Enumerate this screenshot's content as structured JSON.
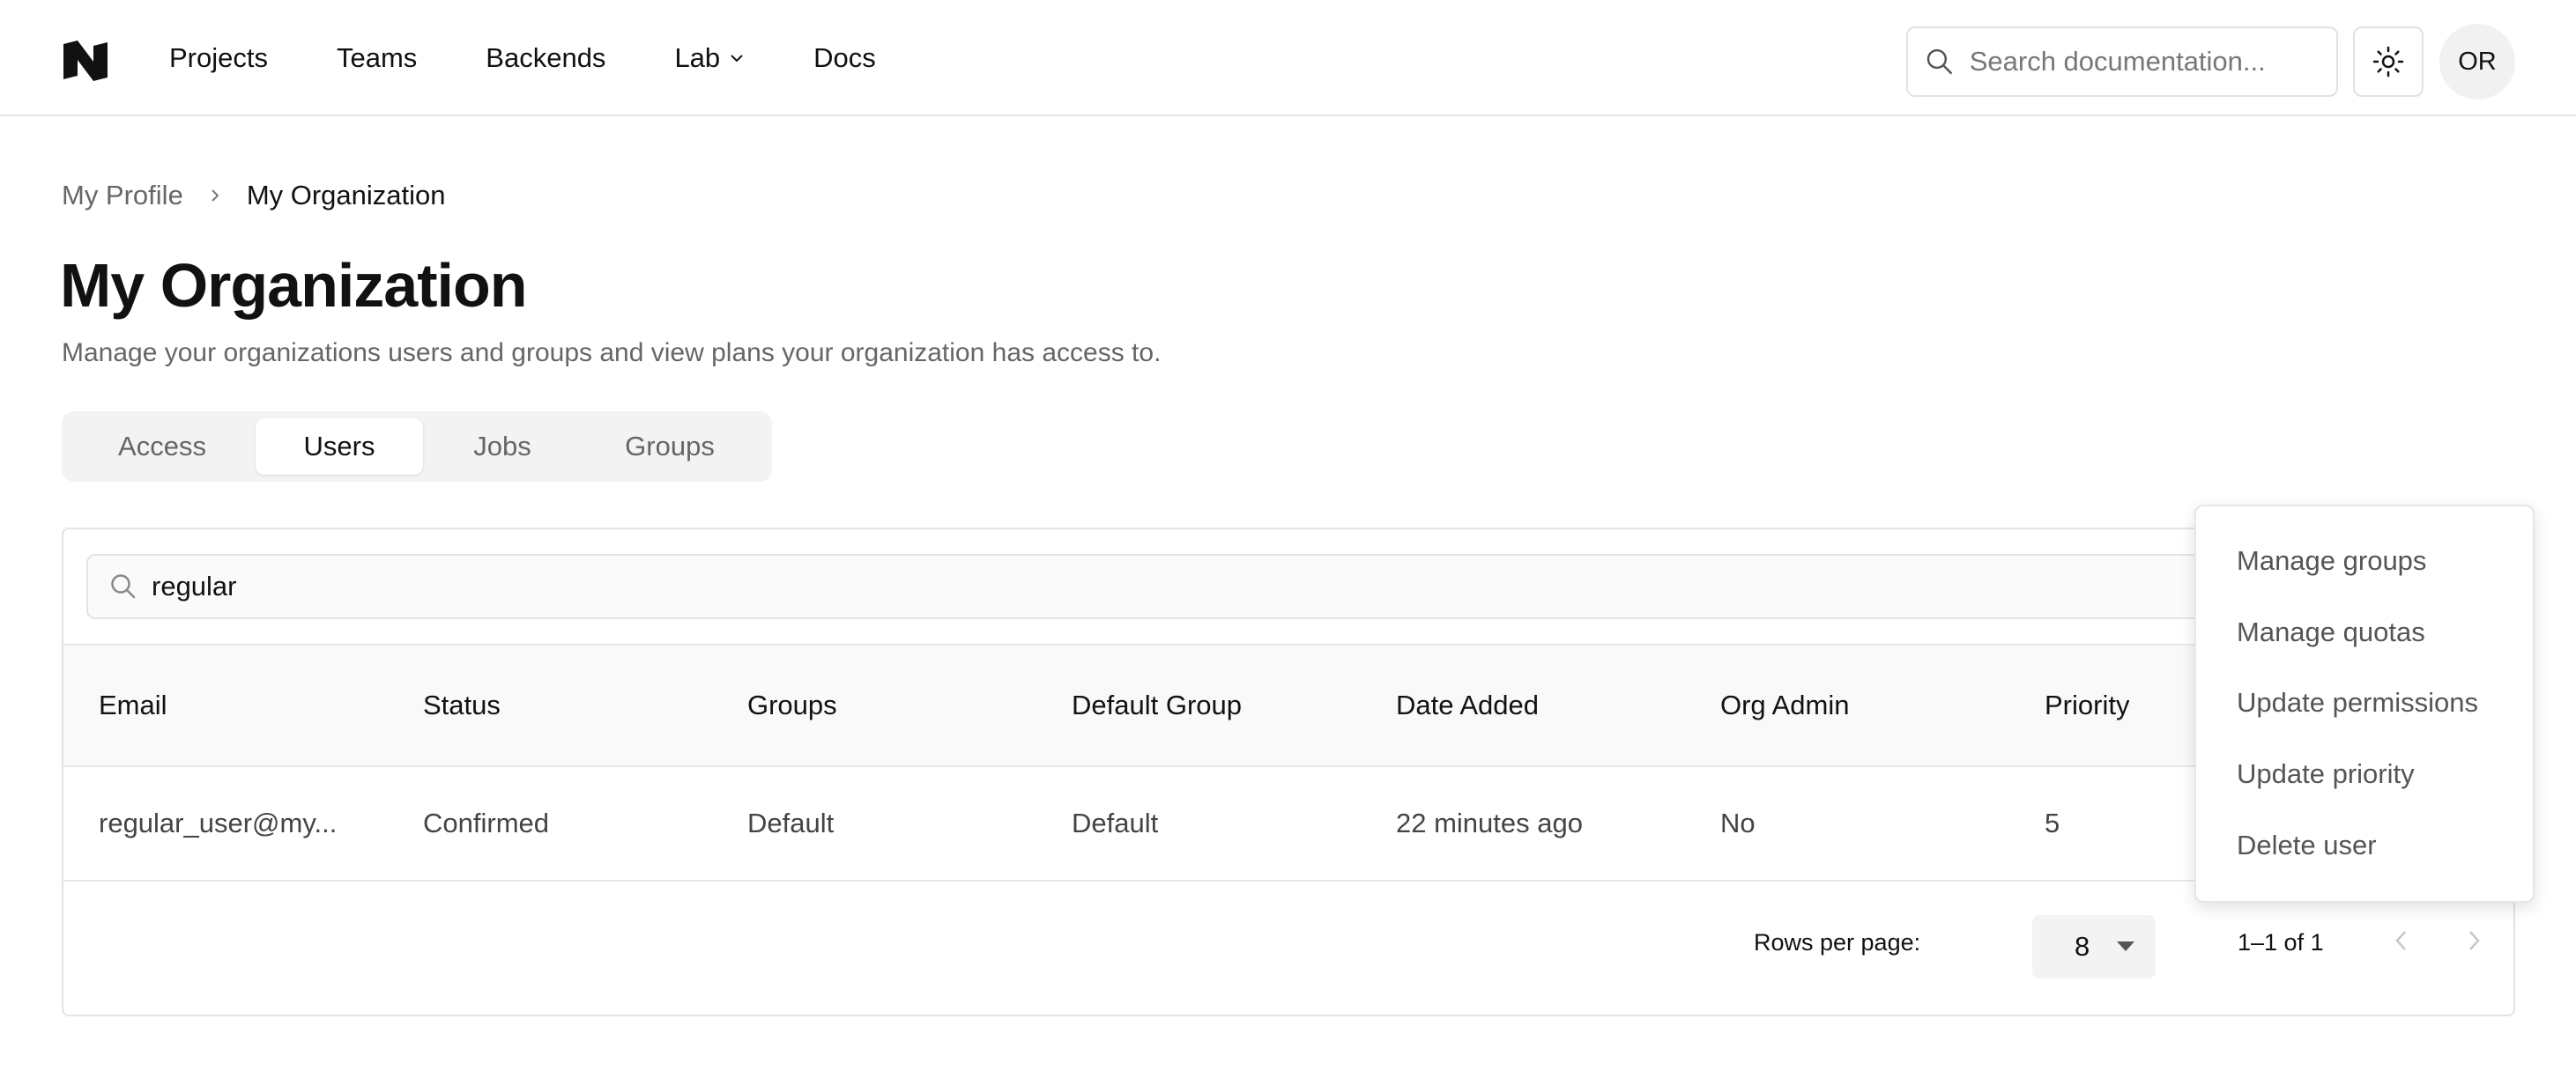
{
  "header": {
    "nav": [
      "Projects",
      "Teams",
      "Backends",
      "Lab",
      "Docs"
    ],
    "search_placeholder": "Search documentation...",
    "avatar_initials": "OR"
  },
  "breadcrumb": {
    "parent": "My Profile",
    "current": "My Organization"
  },
  "page": {
    "title": "My Organization",
    "description": "Manage your organizations users and groups and view plans your organization has access to."
  },
  "tabs": [
    "Access",
    "Users",
    "Jobs",
    "Groups"
  ],
  "active_tab": "Users",
  "filter": {
    "value": "regular"
  },
  "table": {
    "columns": [
      "Email",
      "Status",
      "Groups",
      "Default Group",
      "Date Added",
      "Org Admin",
      "Priority"
    ],
    "rows": [
      [
        "regular_user@my...",
        "Confirmed",
        "Default",
        "Default",
        "22 minutes ago",
        "No",
        "5"
      ]
    ]
  },
  "pagination": {
    "rows_per_page_label": "Rows per page:",
    "rows_per_page": "8",
    "range": "1–1 of 1"
  },
  "menu": [
    "Manage groups",
    "Manage quotas",
    "Update permissions",
    "Update priority",
    "Delete user"
  ]
}
